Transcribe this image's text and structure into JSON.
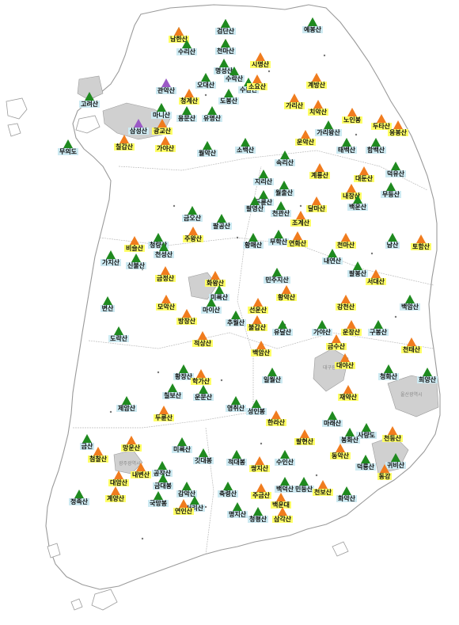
{
  "colors": {
    "land": "#ffffff",
    "border": "#9a9a9a",
    "metro": "#d0d0d0",
    "tri_green": "#1f8a1f",
    "tri_orange": "#f07c1e",
    "tri_purple": "#9b59c6",
    "label_yellow": "#ffff66",
    "label_blue": "#cdeaf2"
  },
  "metro_areas": [
    {
      "name": "대구광역시"
    },
    {
      "name": "울산광역시"
    },
    {
      "name": "광주광역시"
    }
  ],
  "mountains": [
    {
      "name": "신선봉",
      "color": "green",
      "label": "blue"
    },
    {
      "name": "북한산",
      "color": "green",
      "label": "yellow"
    },
    {
      "name": "고대산",
      "color": "green",
      "label": "blue"
    },
    {
      "name": "용화산",
      "color": "orange",
      "label": "yellow"
    },
    {
      "name": "삼악산",
      "color": "green",
      "label": "blue"
    },
    {
      "name": "명성산",
      "color": "green",
      "label": "blue"
    },
    {
      "name": "시명산",
      "color": "orange",
      "label": "yellow"
    },
    {
      "name": "수락산",
      "color": "green",
      "label": "blue"
    },
    {
      "name": "관악산",
      "color": "purple",
      "label": "blue"
    },
    {
      "name": "계방산",
      "color": "orange",
      "label": "yellow"
    },
    {
      "name": "고려산",
      "color": "green",
      "label": "blue"
    },
    {
      "name": "오대산",
      "color": "green",
      "label": "blue"
    },
    {
      "name": "수원산",
      "color": "green",
      "label": "blue"
    },
    {
      "name": "가리산",
      "color": "orange",
      "label": "yellow"
    },
    {
      "name": "도봉산",
      "color": "green",
      "label": "blue"
    },
    {
      "name": "청계산",
      "color": "orange",
      "label": "yellow"
    },
    {
      "name": "마니산",
      "color": "green",
      "label": "blue"
    },
    {
      "name": "소요산",
      "color": "orange",
      "label": "yellow"
    },
    {
      "name": "용문산",
      "color": "green",
      "label": "blue"
    },
    {
      "name": "유명산",
      "color": "green",
      "label": "blue"
    },
    {
      "name": "치악산",
      "color": "orange",
      "label": "yellow"
    },
    {
      "name": "노인봉",
      "color": "orange",
      "label": "yellow"
    },
    {
      "name": "두타산",
      "color": "orange",
      "label": "yellow"
    },
    {
      "name": "가리왕산",
      "color": "green",
      "label": "blue"
    },
    {
      "name": "태백산",
      "color": "green",
      "label": "blue"
    },
    {
      "name": "함백산",
      "color": "green",
      "label": "blue"
    },
    {
      "name": "응봉산",
      "color": "orange",
      "label": "yellow"
    },
    {
      "name": "운악산",
      "color": "orange",
      "label": "yellow"
    },
    {
      "name": "무의도",
      "color": "green",
      "label": "blue"
    },
    {
      "name": "삼성산",
      "color": "purple",
      "label": "blue"
    },
    {
      "name": "광교산",
      "color": "orange",
      "label": "yellow"
    },
    {
      "name": "칠갑산",
      "color": "orange",
      "label": "yellow"
    },
    {
      "name": "가야산",
      "color": "orange",
      "label": "yellow"
    },
    {
      "name": "월악산",
      "color": "green",
      "label": "blue"
    },
    {
      "name": "소백산",
      "color": "green",
      "label": "blue"
    },
    {
      "name": "속리산",
      "color": "green",
      "label": "blue"
    },
    {
      "name": "계룡산",
      "color": "orange",
      "label": "yellow"
    },
    {
      "name": "대둔산",
      "color": "orange",
      "label": "yellow"
    },
    {
      "name": "덕유산",
      "color": "green",
      "label": "blue"
    },
    {
      "name": "지리산",
      "color": "green",
      "label": "blue"
    },
    {
      "name": "내장산",
      "color": "orange",
      "label": "yellow"
    },
    {
      "name": "무등산",
      "color": "green",
      "label": "blue"
    },
    {
      "name": "월출산",
      "color": "green",
      "label": "blue"
    },
    {
      "name": "두륜산",
      "color": "green",
      "label": "blue"
    },
    {
      "name": "달마산",
      "color": "orange",
      "label": "yellow"
    },
    {
      "name": "천관산",
      "color": "green",
      "label": "blue"
    },
    {
      "name": "팔영산",
      "color": "green",
      "label": "blue"
    },
    {
      "name": "조계산",
      "color": "orange",
      "label": "yellow"
    },
    {
      "name": "백운산",
      "color": "green",
      "label": "blue"
    },
    {
      "name": "금오산",
      "color": "green",
      "label": "blue"
    },
    {
      "name": "팔공산",
      "color": "green",
      "label": "blue"
    },
    {
      "name": "주왕산",
      "color": "orange",
      "label": "yellow"
    },
    {
      "name": "청량산",
      "color": "green",
      "label": "blue"
    },
    {
      "name": "비슬산",
      "color": "orange",
      "label": "yellow"
    },
    {
      "name": "가지산",
      "color": "green",
      "label": "blue"
    },
    {
      "name": "신불산",
      "color": "green",
      "label": "blue"
    },
    {
      "name": "천성산",
      "color": "green",
      "label": "blue"
    },
    {
      "name": "금정산",
      "color": "orange",
      "label": "yellow"
    },
    {
      "name": "화왕산",
      "color": "orange",
      "label": "yellow"
    },
    {
      "name": "황매산",
      "color": "green",
      "label": "blue"
    },
    {
      "name": "무학산",
      "color": "green",
      "label": "blue"
    },
    {
      "name": "연화산",
      "color": "orange",
      "label": "yellow"
    },
    {
      "name": "천마산",
      "color": "orange",
      "label": "yellow"
    },
    {
      "name": "남산",
      "color": "green",
      "label": "blue"
    },
    {
      "name": "토함산",
      "color": "orange",
      "label": "yellow"
    },
    {
      "name": "내연산",
      "color": "green",
      "label": "blue"
    },
    {
      "name": "팔봉산",
      "color": "green",
      "label": "blue"
    },
    {
      "name": "서대산",
      "color": "orange",
      "label": "yellow"
    },
    {
      "name": "민주지산",
      "color": "green",
      "label": "blue"
    },
    {
      "name": "황악산",
      "color": "orange",
      "label": "yellow"
    },
    {
      "name": "미륵산",
      "color": "green",
      "label": "blue"
    },
    {
      "name": "모악산",
      "color": "orange",
      "label": "yellow"
    },
    {
      "name": "마이산",
      "color": "green",
      "label": "blue"
    },
    {
      "name": "변산",
      "color": "green",
      "label": "blue"
    },
    {
      "name": "선운산",
      "color": "orange",
      "label": "yellow"
    },
    {
      "name": "방장산",
      "color": "orange",
      "label": "yellow"
    },
    {
      "name": "추월산",
      "color": "green",
      "label": "blue"
    },
    {
      "name": "강천산",
      "color": "orange",
      "label": "yellow"
    },
    {
      "name": "백암산",
      "color": "green",
      "label": "blue"
    },
    {
      "name": "불갑산",
      "color": "orange",
      "label": "yellow"
    },
    {
      "name": "유달산",
      "color": "green",
      "label": "blue"
    },
    {
      "name": "적상산",
      "color": "orange",
      "label": "yellow"
    },
    {
      "name": "가야산",
      "color": "green",
      "label": "blue"
    },
    {
      "name": "운장산",
      "color": "orange",
      "label": "yellow"
    },
    {
      "name": "구봉산",
      "color": "green",
      "label": "blue"
    },
    {
      "name": "천태산",
      "color": "orange",
      "label": "yellow"
    },
    {
      "name": "도락산",
      "color": "green",
      "label": "blue"
    },
    {
      "name": "금수산",
      "color": "orange",
      "label": "yellow"
    },
    {
      "name": "희양산",
      "color": "green",
      "label": "blue"
    },
    {
      "name": "대야산",
      "color": "orange",
      "label": "yellow"
    },
    {
      "name": "청화산",
      "color": "green",
      "label": "blue"
    },
    {
      "name": "황장산",
      "color": "green",
      "label": "blue"
    },
    {
      "name": "학가산",
      "color": "orange",
      "label": "yellow"
    },
    {
      "name": "일월산",
      "color": "green",
      "label": "blue"
    },
    {
      "name": "백암산",
      "color": "orange",
      "label": "yellow"
    },
    {
      "name": "칠보산",
      "color": "green",
      "label": "blue"
    },
    {
      "name": "운문산",
      "color": "green",
      "label": "blue"
    },
    {
      "name": "재약산",
      "color": "orange",
      "label": "yellow"
    },
    {
      "name": "영취산",
      "color": "green",
      "label": "blue"
    },
    {
      "name": "성인봉",
      "color": "green",
      "label": "blue"
    },
    {
      "name": "한라산",
      "color": "orange",
      "label": "yellow"
    },
    {
      "name": "마래산",
      "color": "green",
      "label": "blue"
    },
    {
      "name": "두륜산",
      "color": "orange",
      "label": "yellow"
    },
    {
      "name": "제암산",
      "color": "green",
      "label": "blue"
    },
    {
      "name": "사량도",
      "color": "green",
      "label": "blue"
    },
    {
      "name": "천등산",
      "color": "orange",
      "label": "yellow"
    },
    {
      "name": "금산",
      "color": "green",
      "label": "blue"
    },
    {
      "name": "망운산",
      "color": "orange",
      "label": "yellow"
    },
    {
      "name": "미륵산",
      "color": "green",
      "label": "blue"
    },
    {
      "name": "팔현산",
      "color": "orange",
      "label": "yellow"
    },
    {
      "name": "봉화산",
      "color": "green",
      "label": "blue"
    },
    {
      "name": "첨찰산",
      "color": "orange",
      "label": "yellow"
    },
    {
      "name": "깃대봉",
      "color": "green",
      "label": "blue"
    },
    {
      "name": "적대봉",
      "color": "green",
      "label": "blue"
    },
    {
      "name": "쌍지산",
      "color": "orange",
      "label": "yellow"
    },
    {
      "name": "수인산",
      "color": "green",
      "label": "blue"
    },
    {
      "name": "동악산",
      "color": "orange",
      "label": "yellow"
    },
    {
      "name": "덕룡산",
      "color": "green",
      "label": "blue"
    },
    {
      "name": "귀비산",
      "color": "green",
      "label": "blue"
    },
    {
      "name": "내변산",
      "color": "orange",
      "label": "yellow"
    },
    {
      "name": "공작산",
      "color": "green",
      "label": "blue"
    },
    {
      "name": "대암산",
      "color": "orange",
      "label": "yellow"
    },
    {
      "name": "백덕산",
      "color": "green",
      "label": "blue"
    },
    {
      "name": "민둥산",
      "color": "green",
      "label": "blue"
    },
    {
      "name": "동강",
      "color": "orange",
      "label": "yellow"
    },
    {
      "name": "금대봉",
      "color": "green",
      "label": "blue"
    },
    {
      "name": "감악산",
      "color": "green",
      "label": "blue"
    },
    {
      "name": "천보산",
      "color": "orange",
      "label": "yellow"
    },
    {
      "name": "축령산",
      "color": "green",
      "label": "blue"
    },
    {
      "name": "주금산",
      "color": "orange",
      "label": "yellow"
    },
    {
      "name": "화악산",
      "color": "green",
      "label": "blue"
    },
    {
      "name": "국망봉",
      "color": "green",
      "label": "blue"
    },
    {
      "name": "백운대",
      "color": "orange",
      "label": "yellow"
    },
    {
      "name": "정족산",
      "color": "green",
      "label": "blue"
    },
    {
      "name": "계양산",
      "color": "orange",
      "label": "yellow"
    },
    {
      "name": "서리산",
      "color": "green",
      "label": "blue"
    },
    {
      "name": "연인산",
      "color": "orange",
      "label": "yellow"
    },
    {
      "name": "명지산",
      "color": "green",
      "label": "blue"
    },
    {
      "name": "청평산",
      "color": "green",
      "label": "blue"
    },
    {
      "name": "삼각산",
      "color": "orange",
      "label": "yellow"
    },
    {
      "name": "예봉산",
      "color": "green",
      "label": "blue"
    },
    {
      "name": "검단산",
      "color": "green",
      "label": "blue"
    },
    {
      "name": "남한산",
      "color": "orange",
      "label": "yellow"
    },
    {
      "name": "천마산",
      "color": "green",
      "label": "blue"
    },
    {
      "name": "수리산",
      "color": "green",
      "label": "blue"
    }
  ]
}
